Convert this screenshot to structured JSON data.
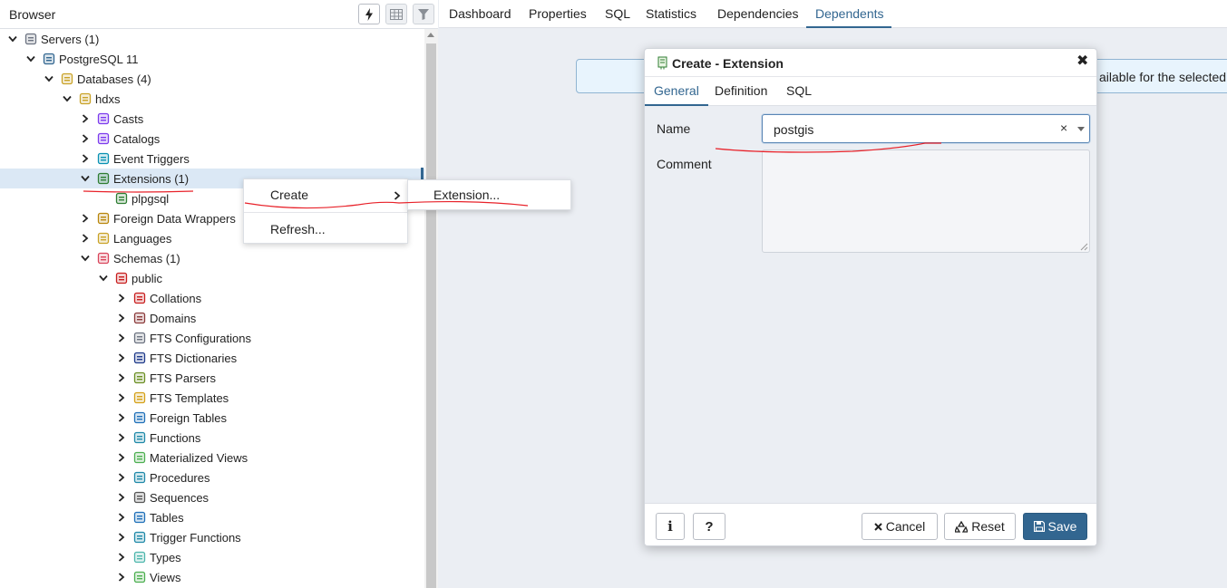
{
  "browser": {
    "title": "Browser",
    "tools": [
      {
        "name": "query-tool",
        "icon": "lightning-icon"
      },
      {
        "name": "view-data",
        "icon": "table-icon"
      },
      {
        "name": "filter-rows",
        "icon": "filter-icon"
      }
    ]
  },
  "tree": [
    {
      "label": "Servers (1)",
      "icon": "servers-icon",
      "expanded": true
    },
    {
      "label": "PostgreSQL 11",
      "icon": "elephant-icon",
      "expanded": true
    },
    {
      "label": "Databases (4)",
      "icon": "databases-icon",
      "expanded": true
    },
    {
      "label": "hdxs",
      "icon": "database-icon",
      "expanded": true
    },
    {
      "label": "Casts",
      "icon": "cast-icon",
      "expanded": false
    },
    {
      "label": "Catalogs",
      "icon": "catalog-icon",
      "expanded": false
    },
    {
      "label": "Event Triggers",
      "icon": "event-trigger-icon",
      "expanded": false
    },
    {
      "label": "Extensions (1)",
      "icon": "extension-icon",
      "expanded": true,
      "selected": true
    },
    {
      "label": "plpgsql",
      "icon": "extension-icon",
      "leaf": true
    },
    {
      "label": "Foreign Data Wrappers",
      "icon": "foreign-data-wrapper-icon",
      "expanded": false
    },
    {
      "label": "Languages",
      "icon": "language-icon",
      "expanded": false
    },
    {
      "label": "Schemas (1)",
      "icon": "schemas-icon",
      "expanded": true
    },
    {
      "label": "public",
      "icon": "schema-icon",
      "expanded": true
    },
    {
      "label": "Collations",
      "icon": "collation-icon",
      "expanded": false
    },
    {
      "label": "Domains",
      "icon": "domain-icon",
      "expanded": false
    },
    {
      "label": "FTS Configurations",
      "icon": "fts-configuration-icon",
      "expanded": false
    },
    {
      "label": "FTS Dictionaries",
      "icon": "fts-dictionary-icon",
      "expanded": false
    },
    {
      "label": "FTS Parsers",
      "icon": "fts-parser-icon",
      "expanded": false
    },
    {
      "label": "FTS Templates",
      "icon": "fts-template-icon",
      "expanded": false
    },
    {
      "label": "Foreign Tables",
      "icon": "foreign-table-icon",
      "expanded": false
    },
    {
      "label": "Functions",
      "icon": "function-icon",
      "expanded": false
    },
    {
      "label": "Materialized Views",
      "icon": "materialized-view-icon",
      "expanded": false
    },
    {
      "label": "Procedures",
      "icon": "procedure-icon",
      "expanded": false
    },
    {
      "label": "Sequences",
      "icon": "sequence-icon",
      "expanded": false
    },
    {
      "label": "Tables",
      "icon": "table-icon",
      "expanded": false
    },
    {
      "label": "Trigger Functions",
      "icon": "trigger-function-icon",
      "expanded": false
    },
    {
      "label": "Types",
      "icon": "type-icon",
      "expanded": false
    },
    {
      "label": "Views",
      "icon": "view-icon",
      "expanded": false
    }
  ],
  "context_menu": {
    "items": [
      "Create",
      "Refresh..."
    ],
    "submenu": [
      "Extension..."
    ]
  },
  "tabs": [
    "Dashboard",
    "Properties",
    "SQL",
    "Statistics",
    "Dependencies",
    "Dependents"
  ],
  "active_tab": "Dependents",
  "info_text": "ailable for the selected o",
  "dialog": {
    "title": "Create - Extension",
    "tabs": [
      "General",
      "Definition",
      "SQL"
    ],
    "active_tab": "General",
    "name_label": "Name",
    "name_value": "postgis",
    "clear_glyph": "×",
    "comment_label": "Comment",
    "comment_value": "",
    "info_glyph": "i",
    "help_glyph": "?",
    "cancel_label": "Cancel",
    "reset_label": "Reset",
    "save_label": "Save"
  },
  "colors": {
    "accent": "#326690",
    "selected_row": "#dbe8f5",
    "annotation": "#e8222a",
    "banner_bg": "#e8f4fd"
  }
}
